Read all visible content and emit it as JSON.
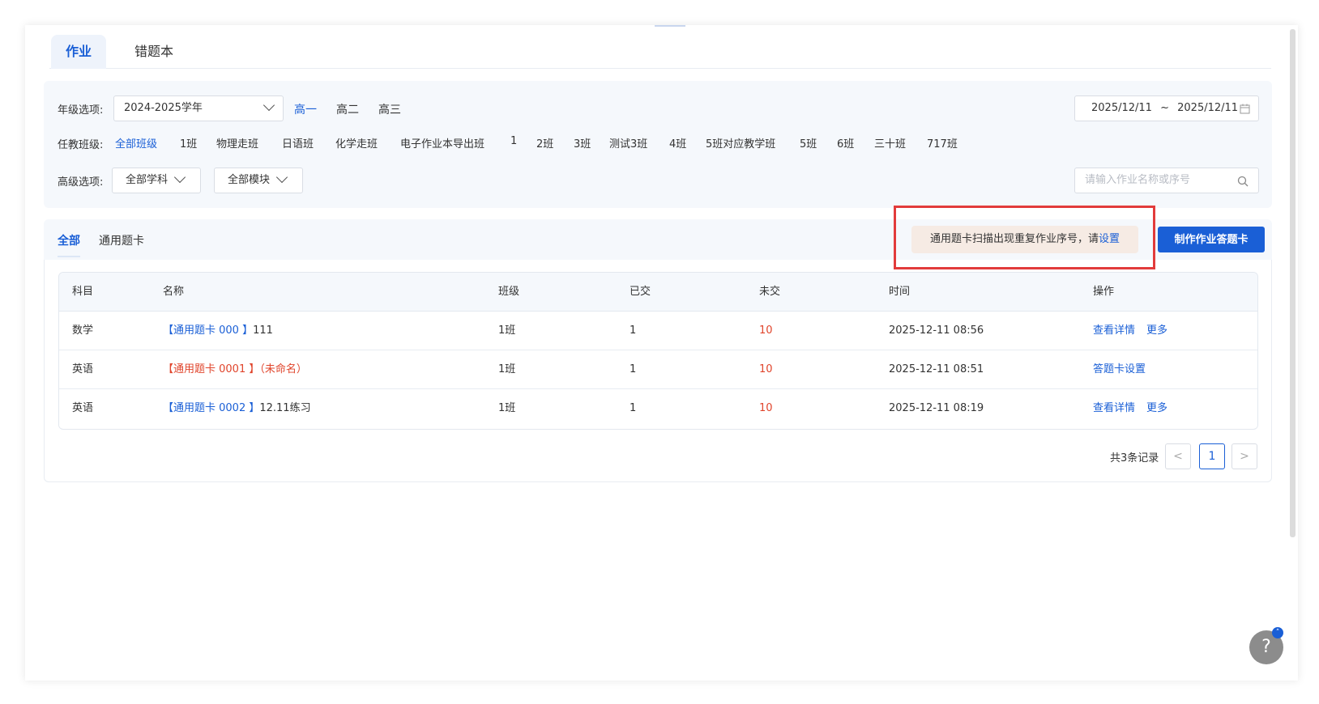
{
  "tabs": {
    "homework": "作业",
    "wrongbook": "错题本"
  },
  "filters": {
    "grade_label": "年级选项:",
    "year_value": "2024-2025学年",
    "grades": [
      "高一",
      "高二",
      "高三"
    ],
    "class_label": "任教班级:",
    "classes": [
      "全部班级",
      "1班",
      "物理走班",
      "日语班",
      "化学走班",
      "电子作业本导出班",
      "1",
      "2班",
      "3班",
      "测试3班",
      "4班",
      "5班对应教学班",
      "5班",
      "6班",
      "三十班",
      "717班"
    ],
    "advanced_label": "高级选项:",
    "subject_value": "全部学科",
    "module_value": "全部模块",
    "date_start": "2025/12/11",
    "date_sep": "~",
    "date_end": "2025/12/11",
    "search_placeholder": "请输入作业名称或序号"
  },
  "subtabs": {
    "all": "全部",
    "general": "通用题卡"
  },
  "notice": {
    "text": "通用题卡扫描出现重复作业序号，请",
    "link": "设置"
  },
  "make_button": "制作作业答题卡",
  "table": {
    "headers": [
      "科目",
      "名称",
      "班级",
      "已交",
      "未交",
      "时间",
      "操作"
    ],
    "rows": [
      {
        "subject": "数学",
        "name_tag": "【通用题卡 000 】",
        "name_title": "111",
        "class": "1班",
        "submitted": "1",
        "unsubmitted": "10",
        "time": "2025-12-11 08:56",
        "ops": [
          "查看详情",
          "更多"
        ],
        "warn": false
      },
      {
        "subject": "英语",
        "name_tag": "【通用题卡 0001 】",
        "name_title": "（未命名）",
        "class": "1班",
        "submitted": "1",
        "unsubmitted": "10",
        "time": "2025-12-11 08:51",
        "ops": [
          "答题卡设置"
        ],
        "warn": true
      },
      {
        "subject": "英语",
        "name_tag": "【通用题卡 0002 】",
        "name_title": "12.11练习",
        "class": "1班",
        "submitted": "1",
        "unsubmitted": "10",
        "time": "2025-12-11 08:19",
        "ops": [
          "查看详情",
          "更多"
        ],
        "warn": false
      }
    ]
  },
  "pager": {
    "total": "共3条记录",
    "prev": "<",
    "current": "1",
    "next": ">"
  },
  "help": "?",
  "colors": {
    "primary": "#1a5fd6",
    "danger": "#e0442b",
    "highlight": "#e23b3b"
  }
}
